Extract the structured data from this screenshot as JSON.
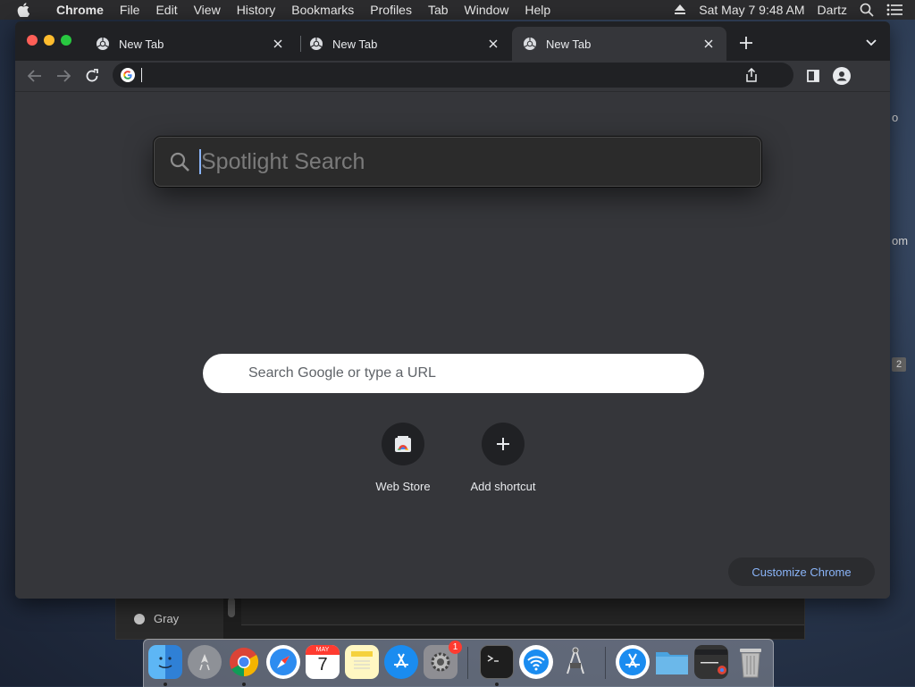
{
  "menubar": {
    "apple_icon": "apple-icon",
    "items": [
      "Chrome",
      "File",
      "Edit",
      "View",
      "History",
      "Bookmarks",
      "Profiles",
      "Tab",
      "Window",
      "Help"
    ],
    "clock": "Sat May 7  9:48 AM",
    "user": "Dartz",
    "status_icons": [
      "eject-icon",
      "search-icon",
      "list-icon"
    ]
  },
  "tabs": [
    {
      "title": "New Tab",
      "active": false
    },
    {
      "title": "New Tab",
      "active": false
    },
    {
      "title": "New Tab",
      "active": true
    }
  ],
  "toolbar": {
    "omnibox_value": ""
  },
  "spotlight": {
    "placeholder": "Spotlight Search"
  },
  "newtab": {
    "search_placeholder": "Search Google or type a URL",
    "shortcuts": [
      {
        "label": "Web Store",
        "icon": "web-store-icon"
      },
      {
        "label": "Add shortcut",
        "icon": "plus-icon"
      }
    ],
    "customize_label": "Customize Chrome"
  },
  "background_window": {
    "list_item": "Gray"
  },
  "desktop_fragments": {
    "frag1": "o",
    "frag2": "om",
    "frag3": "2"
  },
  "dock": {
    "items": [
      "Finder",
      "Launchpad",
      "Chrome",
      "Safari",
      "Calendar",
      "Notes",
      "App Store",
      "System Preferences",
      "Terminal",
      "Wireless Diagnostics",
      "Instruments",
      "App Store Downloads",
      "Folder",
      "Chrome Window",
      "Trash"
    ],
    "calendar_month": "MAY",
    "calendar_day": "7",
    "sysprefs_badge": "1"
  },
  "colors": {
    "tab_bg": "#202124",
    "content_bg": "#35363a",
    "accent": "#8ab4f8"
  }
}
